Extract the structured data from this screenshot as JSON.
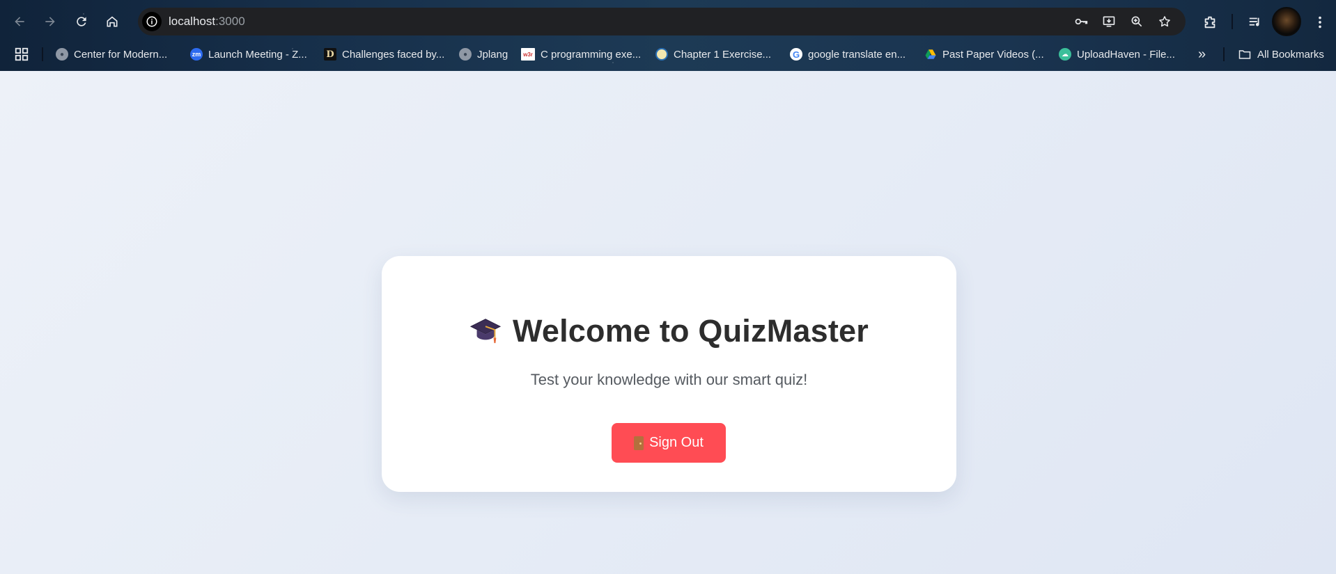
{
  "browser": {
    "url_host": "localhost",
    "url_port": ":3000",
    "bookmarks": [
      {
        "label": "Center for Modern...",
        "icon": "globe-icon"
      },
      {
        "label": "Launch Meeting - Z...",
        "icon": "zoom-icon",
        "icon_text": "zm"
      },
      {
        "label": "Challenges faced by...",
        "icon": "d-logo-icon",
        "icon_text": "D"
      },
      {
        "label": "Jplang",
        "icon": "globe-icon"
      },
      {
        "label": "C programming exe...",
        "icon": "w3r-icon",
        "icon_text": "w3r"
      },
      {
        "label": "Chapter 1 Exercise...",
        "icon": "chapter-icon"
      },
      {
        "label": "google translate en...",
        "icon": "google-icon",
        "icon_text": "G"
      },
      {
        "label": "Past Paper Videos (...",
        "icon": "google-drive-icon"
      },
      {
        "label": "UploadHaven - File...",
        "icon": "cloud-icon"
      }
    ],
    "more_bookmarks": "»",
    "all_bookmarks": "All Bookmarks"
  },
  "main": {
    "title": "Welcome to QuizMaster",
    "subtitle": "Test your knowledge with our smart quiz!",
    "signout_label": "Sign Out",
    "colors": {
      "signout_bg": "#ff4c54",
      "card_bg": "#ffffff",
      "page_bg": "#e8eef7"
    }
  }
}
